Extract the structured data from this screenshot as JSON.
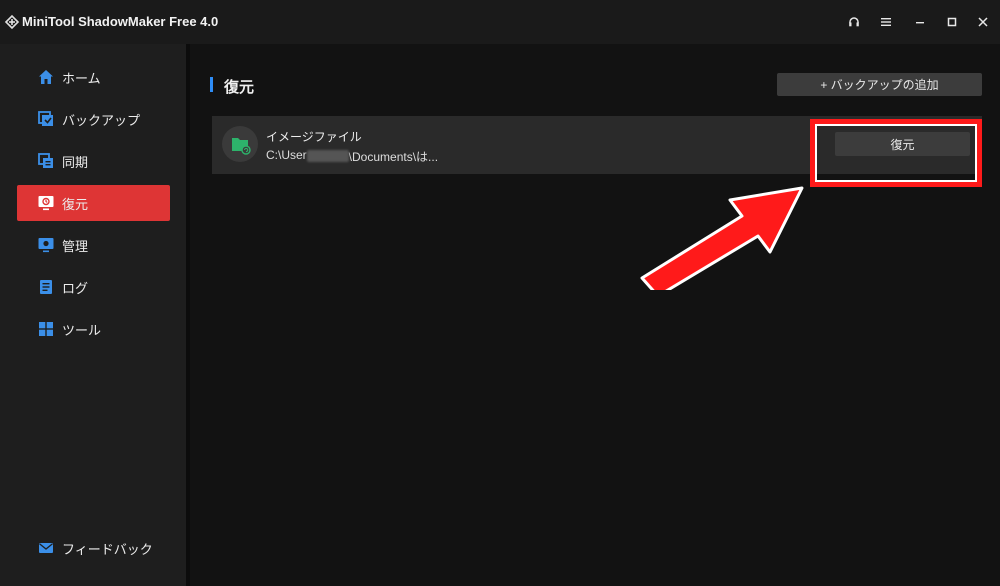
{
  "window": {
    "title": "MiniTool ShadowMaker Free 4.0",
    "logo_icon": "minitool-logo-icon",
    "controls": [
      {
        "name": "headset-icon",
        "glyph": "🎧"
      },
      {
        "name": "menu-icon",
        "glyph": "≡"
      },
      {
        "name": "minimize-icon",
        "glyph": "—"
      },
      {
        "name": "maximize-icon",
        "glyph": "□"
      },
      {
        "name": "close-icon",
        "glyph": "✕"
      }
    ]
  },
  "sidebar": {
    "items": [
      {
        "label": "ホーム",
        "icon": "home-icon"
      },
      {
        "label": "バックアップ",
        "icon": "backup-icon"
      },
      {
        "label": "同期",
        "icon": "sync-icon"
      },
      {
        "label": "復元",
        "icon": "restore-icon",
        "active": true
      },
      {
        "label": "管理",
        "icon": "manage-icon"
      },
      {
        "label": "ログ",
        "icon": "log-icon"
      },
      {
        "label": "ツール",
        "icon": "tools-icon"
      }
    ],
    "feedback": {
      "label": "フィードバック",
      "icon": "mail-icon"
    }
  },
  "main": {
    "title": "復元",
    "add_backup_label": "+ バックアップの追加",
    "backup": {
      "title": "イメージファイル",
      "path_prefix": "C:\\User",
      "path_suffix": "\\Documents\\は...",
      "restore_label": "復元",
      "icon": "folder-restore-icon"
    }
  },
  "colors": {
    "accent_active": "#de3535",
    "title_accent": "#2e8df7",
    "annotation": "#ff1a1a",
    "icon_blue": "#3b8fe8",
    "folder_green": "#2db36b"
  }
}
